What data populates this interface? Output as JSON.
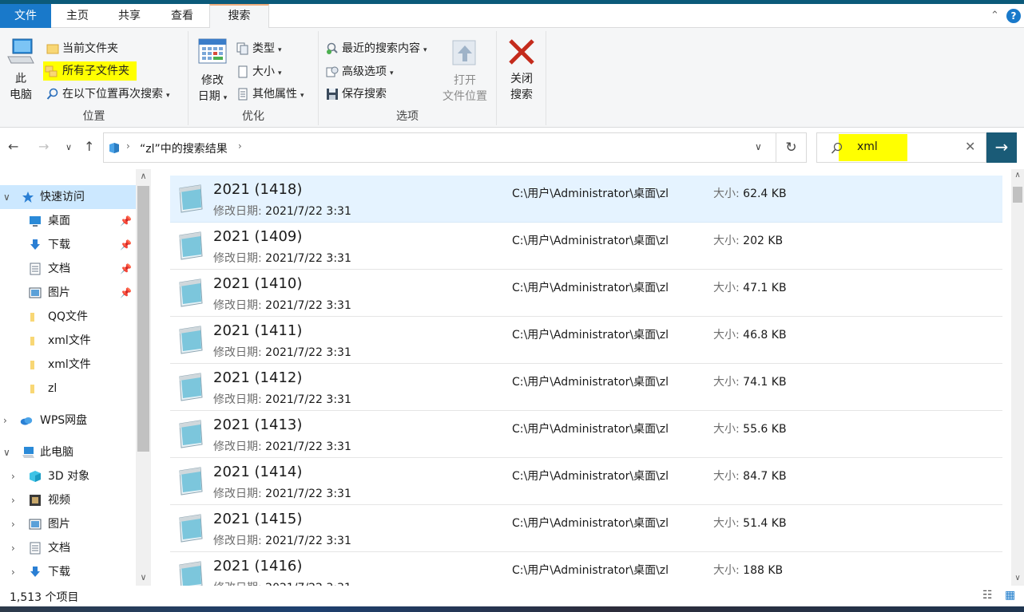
{
  "tabs": {
    "file": "文件",
    "home": "主页",
    "share": "共享",
    "view": "查看",
    "search": "搜索"
  },
  "ribbon": {
    "location": {
      "this_pc_line1": "此",
      "this_pc_line2": "电脑",
      "current_folder": "当前文件夹",
      "all_subfolders": "所有子文件夹",
      "search_again": "在以下位置再次搜索",
      "label": "位置"
    },
    "refine": {
      "date_line1": "修改",
      "date_line2": "日期",
      "kind": "类型",
      "size": "大小",
      "other_props": "其他属性",
      "label": "优化"
    },
    "options": {
      "recent": "最近的搜索内容",
      "advanced": "高级选项",
      "save": "保存搜索",
      "open_line1": "打开",
      "open_line2": "文件位置",
      "label": "选项"
    },
    "close": {
      "line1": "关闭",
      "line2": "搜索"
    }
  },
  "address": {
    "path": "“zl”中的搜索结果"
  },
  "search": {
    "query": "xml"
  },
  "sidebar": {
    "quick_access": "快速访问",
    "items": [
      {
        "label": "桌面",
        "icon": "desktop-icon",
        "pinned": true
      },
      {
        "label": "下载",
        "icon": "download-icon",
        "pinned": true
      },
      {
        "label": "文档",
        "icon": "document-icon",
        "pinned": true
      },
      {
        "label": "图片",
        "icon": "picture-icon",
        "pinned": true
      },
      {
        "label": "QQ文件",
        "icon": "folder-icon",
        "pinned": false
      },
      {
        "label": "xml文件",
        "icon": "folder-icon",
        "pinned": false
      },
      {
        "label": "xml文件",
        "icon": "folder-icon",
        "pinned": false
      },
      {
        "label": "zl",
        "icon": "folder-icon",
        "pinned": false
      }
    ],
    "wps": "WPS网盘",
    "this_pc": "此电脑",
    "pc_items": [
      {
        "label": "3D 对象",
        "icon": "3d-objects-icon"
      },
      {
        "label": "视频",
        "icon": "video-icon"
      },
      {
        "label": "图片",
        "icon": "picture-icon"
      },
      {
        "label": "文档",
        "icon": "document-icon"
      },
      {
        "label": "下载",
        "icon": "download-icon"
      }
    ]
  },
  "results": {
    "date_key": "修改日期:",
    "size_key": "大小:",
    "rows": [
      {
        "name": "2021 (1418)",
        "date": "2021/7/22 3:31",
        "path": "C:\\用户\\Administrator\\桌面\\zl",
        "size": "62.4 KB"
      },
      {
        "name": "2021 (1409)",
        "date": "2021/7/22 3:31",
        "path": "C:\\用户\\Administrator\\桌面\\zl",
        "size": "202 KB"
      },
      {
        "name": "2021 (1410)",
        "date": "2021/7/22 3:31",
        "path": "C:\\用户\\Administrator\\桌面\\zl",
        "size": "47.1 KB"
      },
      {
        "name": "2021 (1411)",
        "date": "2021/7/22 3:31",
        "path": "C:\\用户\\Administrator\\桌面\\zl",
        "size": "46.8 KB"
      },
      {
        "name": "2021 (1412)",
        "date": "2021/7/22 3:31",
        "path": "C:\\用户\\Administrator\\桌面\\zl",
        "size": "74.1 KB"
      },
      {
        "name": "2021 (1413)",
        "date": "2021/7/22 3:31",
        "path": "C:\\用户\\Administrator\\桌面\\zl",
        "size": "55.6 KB"
      },
      {
        "name": "2021 (1414)",
        "date": "2021/7/22 3:31",
        "path": "C:\\用户\\Administrator\\桌面\\zl",
        "size": "84.7 KB"
      },
      {
        "name": "2021 (1415)",
        "date": "2021/7/22 3:31",
        "path": "C:\\用户\\Administrator\\桌面\\zl",
        "size": "51.4 KB"
      },
      {
        "name": "2021 (1416)",
        "date": "2021/7/22 3:31",
        "path": "C:\\用户\\Administrator\\桌面\\zl",
        "size": "188 KB"
      }
    ]
  },
  "status": {
    "count": "1,513 个项目"
  },
  "colors": {
    "accent": "#1979ca",
    "highlight": "#ffff00",
    "selection": "#cce8ff",
    "row_selection": "#e5f3ff",
    "search_go": "#1a5b77",
    "close_red": "#c42b1c"
  }
}
